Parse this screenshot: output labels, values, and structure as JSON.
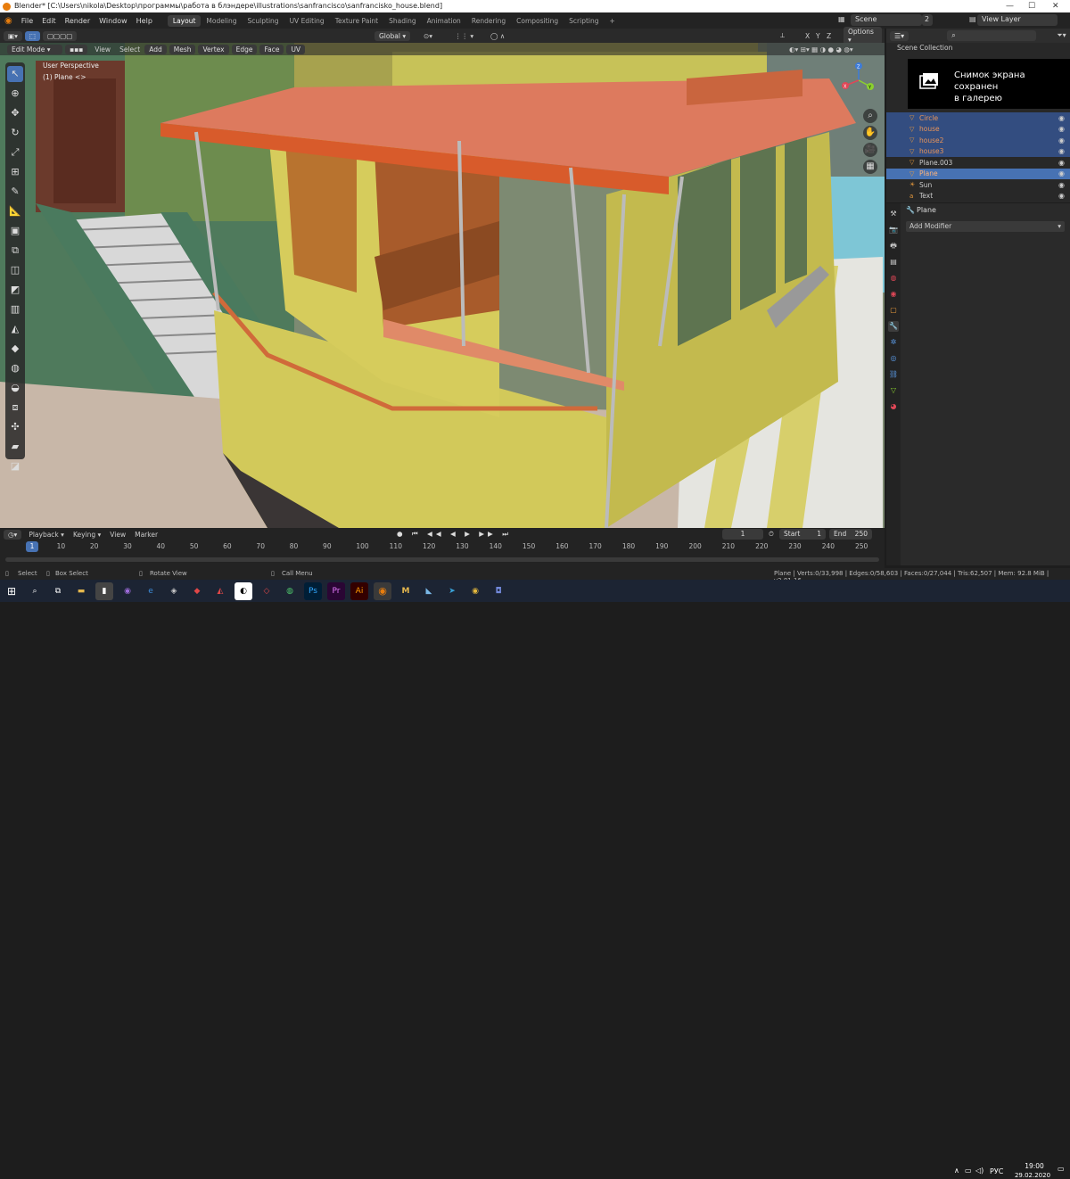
{
  "window": {
    "title": "Blender* [C:\\Users\\nikola\\Desktop\\программы\\работа в блэндере\\illustrations\\sanfrancisco\\sanfrancisko_house.blend]"
  },
  "menus": [
    "File",
    "Edit",
    "Render",
    "Window",
    "Help"
  ],
  "workspaces": [
    {
      "label": "Layout",
      "active": true
    },
    {
      "label": "Modeling"
    },
    {
      "label": "Sculpting"
    },
    {
      "label": "UV Editing"
    },
    {
      "label": "Texture Paint"
    },
    {
      "label": "Shading"
    },
    {
      "label": "Animation"
    },
    {
      "label": "Rendering"
    },
    {
      "label": "Compositing"
    },
    {
      "label": "Scripting"
    }
  ],
  "scene": {
    "label": "Scene",
    "count": "2",
    "view_layer": "View Layer"
  },
  "viewport_header": {
    "mode": "Edit Mode",
    "menus": [
      "View",
      "Select",
      "Add",
      "Mesh",
      "Vertex",
      "Edge",
      "Face",
      "UV"
    ],
    "orientation": "Global",
    "options": "Options",
    "axes": [
      "X",
      "Y",
      "Z"
    ]
  },
  "viewport": {
    "perspective": "User Perspective",
    "object": "(1) Plane <>",
    "gizmo": {
      "x": "X",
      "y": "Y",
      "z": "Z"
    }
  },
  "outliner": {
    "title": "Scene Collection",
    "items": [
      {
        "label": "Circle",
        "selected": true
      },
      {
        "label": "house",
        "selected": true
      },
      {
        "label": "house2",
        "selected": true
      },
      {
        "label": "house3",
        "selected": true
      },
      {
        "label": "Plane.003",
        "selected": false
      },
      {
        "label": "Plane",
        "selected": true,
        "active": true
      },
      {
        "label": "Sun",
        "selected": false
      },
      {
        "label": "Text",
        "selected": false
      }
    ]
  },
  "toast": {
    "line1": "Снимок экрана сохранен",
    "line2": "в галерею"
  },
  "properties": {
    "object": "Plane",
    "add_modifier": "Add Modifier"
  },
  "timeline": {
    "menus": [
      "Playback",
      "Keying",
      "View",
      "Marker"
    ],
    "current_frame": "1",
    "start_label": "Start",
    "start": "1",
    "end_label": "End",
    "end": "250",
    "ticks": [
      "1",
      "10",
      "20",
      "30",
      "40",
      "50",
      "60",
      "70",
      "80",
      "90",
      "100",
      "110",
      "120",
      "130",
      "140",
      "150",
      "160",
      "170",
      "180",
      "190",
      "200",
      "210",
      "220",
      "230",
      "240",
      "250"
    ]
  },
  "statusbar": {
    "select": "Select",
    "box_select": "Box Select",
    "rotate": "Rotate View",
    "call_menu": "Call Menu",
    "stats": "Plane | Verts:0/33,998 | Edges:0/58,603 | Faces:0/27,044 | Tris:62,507 | Mem: 92.8 MiB | v2.81.16"
  },
  "taskbar": {
    "apps": [
      "Ps",
      "Pr",
      "Ai",
      "M"
    ],
    "lang": "РУС",
    "time": "19:00",
    "date": "29.02.2020"
  },
  "colors": {
    "accent": "#4772b3",
    "select_row": "#334d80"
  }
}
